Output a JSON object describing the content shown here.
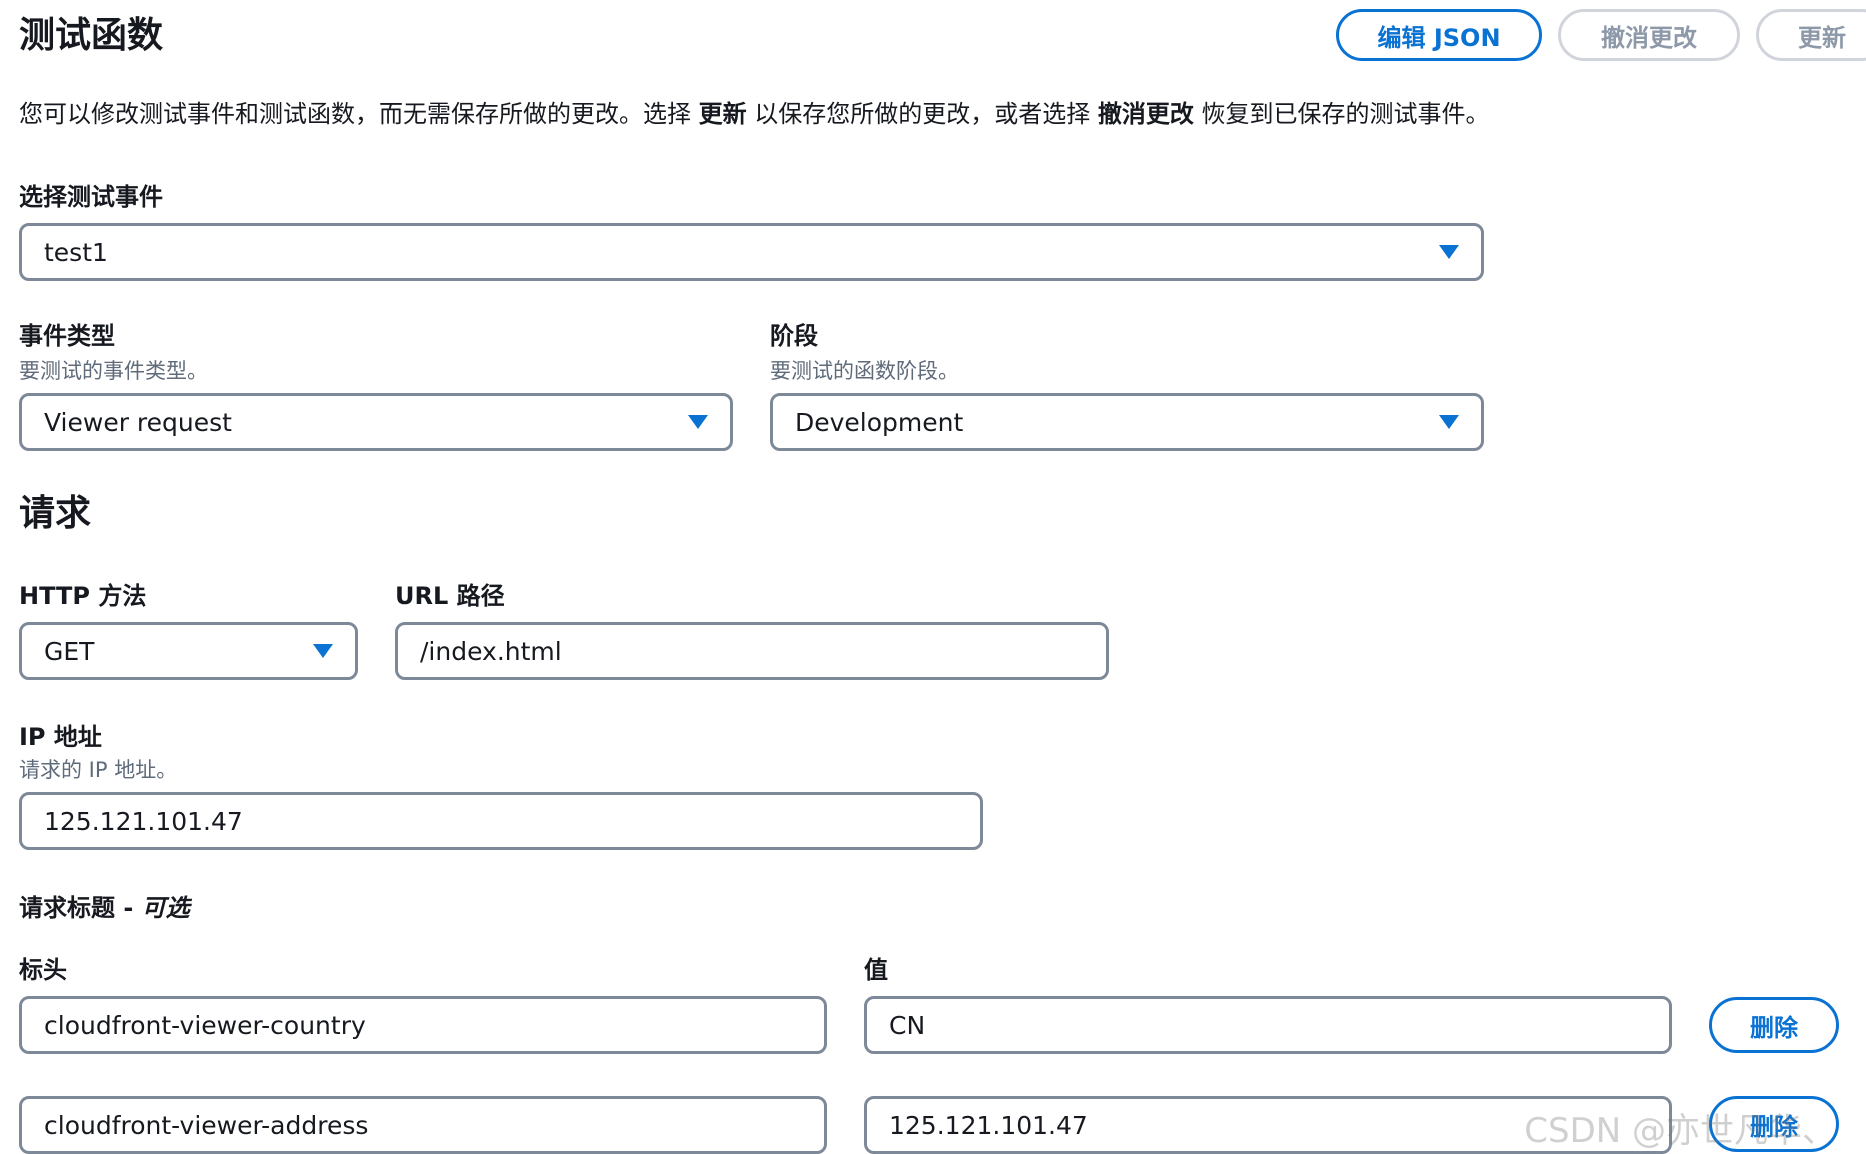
{
  "header": {
    "title": "测试函数",
    "edit_json_label": "编辑 JSON",
    "revert_label": "撤消更改",
    "update_label": "更新"
  },
  "description": {
    "part1": "您可以修改测试事件和测试函数，而无需保存所做的更改。选择 ",
    "bold1": "更新",
    "part2": " 以保存您所做的更改，或者选择 ",
    "bold2": "撤消更改",
    "part3": " 恢复到已保存的测试事件。"
  },
  "test_event": {
    "label": "选择测试事件",
    "value": "test1"
  },
  "event_type": {
    "label": "事件类型",
    "description": "要测试的事件类型。",
    "value": "Viewer request"
  },
  "stage": {
    "label": "阶段",
    "description": "要测试的函数阶段。",
    "value": "Development"
  },
  "request": {
    "title": "请求",
    "http_method": {
      "label": "HTTP 方法",
      "value": "GET"
    },
    "url_path": {
      "label": "URL 路径",
      "value": "/index.html"
    },
    "ip_address": {
      "label": "IP 地址",
      "description": "请求的 IP 地址。",
      "value": "125.121.101.47"
    }
  },
  "headers": {
    "title": "请求标题 - ",
    "optional": "可选",
    "key_label": "标头",
    "value_label": "值",
    "remove_label": "删除",
    "rows": [
      {
        "key": "cloudfront-viewer-country",
        "value": "CN"
      },
      {
        "key": "cloudfront-viewer-address",
        "value": "125.121.101.47"
      }
    ]
  },
  "watermark": "CSDN @亦世凡华、",
  "colors": {
    "accent": "#0972d3",
    "border": "#7d8998",
    "disabled": "#8d99a8"
  }
}
